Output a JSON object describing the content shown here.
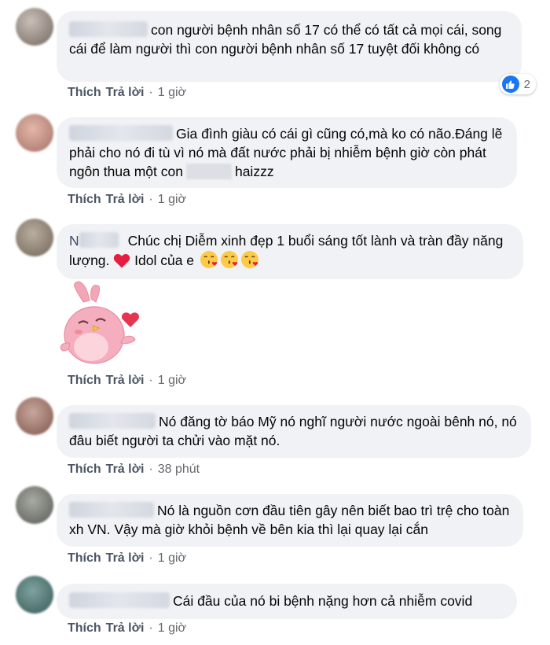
{
  "comments": [
    {
      "text": "con người bệnh nhân số 17 có thể có tất cả mọi cái, song cái để làm người thì con người bệnh nhân số 17 tuyệt đối không có",
      "actions": {
        "like": "Thích",
        "reply": "Trả lời",
        "sep": "·",
        "time": "1 giờ"
      },
      "reaction_count": "2"
    },
    {
      "text_before": "Gia đình giàu có cái gì cũng có,mà ko có não.Đáng lẽ phải cho nó đi tù vì nó mà đất nước phải bị nhiễm bệnh giờ còn phát ngôn thua một con",
      "text_after": "haizzz",
      "actions": {
        "like": "Thích",
        "reply": "Trả lời",
        "sep": "·",
        "time": "1 giờ"
      }
    },
    {
      "name_initial": "N",
      "text": "Chúc chị Diễm xinh đẹp 1 buổi sáng tốt lành và tràn đầy năng lượng.",
      "text_idol": "Idol của e",
      "sticker": "pink-bird-blowing-kiss",
      "actions": {
        "like": "Thích",
        "reply": "Trả lời",
        "sep": "·",
        "time": "1 giờ"
      }
    },
    {
      "text": "Nó đăng tờ báo Mỹ nó nghĩ người nước ngoài bênh nó, nó đâu biết người ta chửi vào mặt nó.",
      "actions": {
        "like": "Thích",
        "reply": "Trả lời",
        "sep": "·",
        "time": "38 phút"
      }
    },
    {
      "text": "Nó là nguồn cơn đầu tiên gây nên biết bao trì trệ cho toàn xh VN. Vậy mà giờ khỏi bệnh về bên kia thì lại quay lại cắn",
      "actions": {
        "like": "Thích",
        "reply": "Trả lời",
        "sep": "·",
        "time": "1 giờ"
      }
    },
    {
      "text": "Cái đầu của nó bi bệnh nặng hơn cả nhiễm covid",
      "actions": {
        "like": "Thích",
        "reply": "Trả lời",
        "sep": "·",
        "time": "1 giờ"
      }
    }
  ],
  "colors": {
    "bubble": "#f0f2f5",
    "action_text": "#65676b",
    "like_blue": "#1877f2",
    "heart_red": "#e41e3f"
  }
}
